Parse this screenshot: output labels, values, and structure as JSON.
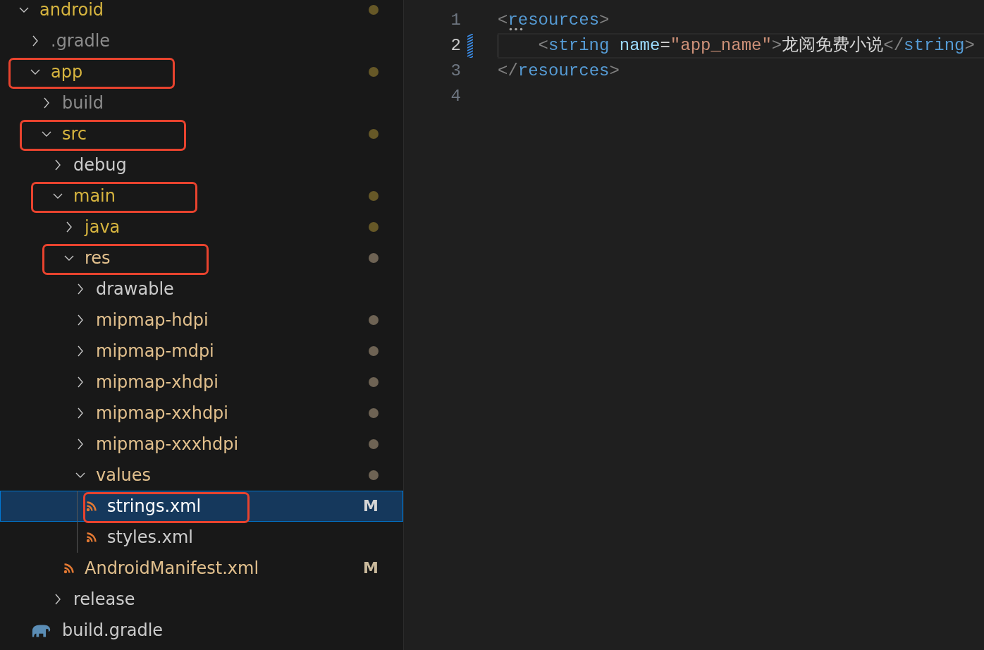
{
  "explorer": {
    "items": [
      {
        "label": "android",
        "kind": "folder",
        "expanded": true,
        "warning": true,
        "modified": false,
        "ignored": false,
        "selected": false,
        "annotated": false,
        "children": [
          {
            "label": ".gradle",
            "kind": "folder",
            "expanded": false,
            "warning": false,
            "modified": false,
            "ignored": true,
            "selected": false,
            "annotated": false
          },
          {
            "label": "app",
            "kind": "folder",
            "expanded": true,
            "warning": true,
            "modified": false,
            "ignored": false,
            "selected": false,
            "annotated": true,
            "children": [
              {
                "label": "build",
                "kind": "folder",
                "expanded": false,
                "warning": false,
                "modified": false,
                "ignored": true,
                "selected": false,
                "annotated": false
              },
              {
                "label": "src",
                "kind": "folder",
                "expanded": true,
                "warning": true,
                "modified": false,
                "ignored": false,
                "selected": false,
                "annotated": true,
                "children": [
                  {
                    "label": "debug",
                    "kind": "folder",
                    "expanded": false,
                    "warning": false,
                    "modified": false,
                    "ignored": false,
                    "selected": false,
                    "annotated": false
                  },
                  {
                    "label": "main",
                    "kind": "folder",
                    "expanded": true,
                    "warning": true,
                    "modified": false,
                    "ignored": false,
                    "selected": false,
                    "annotated": true,
                    "children": [
                      {
                        "label": "java",
                        "kind": "folder",
                        "expanded": false,
                        "warning": true,
                        "modified": false,
                        "ignored": false,
                        "selected": false,
                        "annotated": false
                      },
                      {
                        "label": "res",
                        "kind": "folder",
                        "expanded": true,
                        "warning": false,
                        "modified": true,
                        "ignored": false,
                        "selected": false,
                        "annotated": true,
                        "children": [
                          {
                            "label": "drawable",
                            "kind": "folder",
                            "expanded": false,
                            "warning": false,
                            "modified": false,
                            "ignored": false,
                            "selected": false,
                            "annotated": false
                          },
                          {
                            "label": "mipmap-hdpi",
                            "kind": "folder",
                            "expanded": false,
                            "warning": false,
                            "modified": true,
                            "ignored": false,
                            "selected": false,
                            "annotated": false
                          },
                          {
                            "label": "mipmap-mdpi",
                            "kind": "folder",
                            "expanded": false,
                            "warning": false,
                            "modified": true,
                            "ignored": false,
                            "selected": false,
                            "annotated": false
                          },
                          {
                            "label": "mipmap-xhdpi",
                            "kind": "folder",
                            "expanded": false,
                            "warning": false,
                            "modified": true,
                            "ignored": false,
                            "selected": false,
                            "annotated": false
                          },
                          {
                            "label": "mipmap-xxhdpi",
                            "kind": "folder",
                            "expanded": false,
                            "warning": false,
                            "modified": true,
                            "ignored": false,
                            "selected": false,
                            "annotated": false
                          },
                          {
                            "label": "mipmap-xxxhdpi",
                            "kind": "folder",
                            "expanded": false,
                            "warning": false,
                            "modified": true,
                            "ignored": false,
                            "selected": false,
                            "annotated": false
                          },
                          {
                            "label": "values",
                            "kind": "folder",
                            "expanded": true,
                            "warning": false,
                            "modified": true,
                            "ignored": false,
                            "selected": false,
                            "annotated": false,
                            "children": [
                              {
                                "label": "strings.xml",
                                "kind": "xml",
                                "warning": false,
                                "modified": true,
                                "ignored": false,
                                "badge": "M",
                                "selected": true,
                                "annotated": true
                              },
                              {
                                "label": "styles.xml",
                                "kind": "xml",
                                "warning": false,
                                "modified": false,
                                "ignored": false,
                                "selected": false,
                                "annotated": false
                              }
                            ]
                          }
                        ]
                      },
                      {
                        "label": "AndroidManifest.xml",
                        "kind": "xml",
                        "warning": false,
                        "modified": true,
                        "ignored": false,
                        "badge": "M",
                        "selected": false,
                        "annotated": false
                      }
                    ]
                  },
                  {
                    "label": "release",
                    "kind": "folder",
                    "expanded": false,
                    "warning": false,
                    "modified": false,
                    "ignored": false,
                    "selected": false,
                    "annotated": false
                  }
                ]
              },
              {
                "label": "build.gradle",
                "kind": "gradle",
                "warning": false,
                "modified": false,
                "ignored": false,
                "selected": false,
                "annotated": false
              }
            ]
          }
        ]
      }
    ]
  },
  "editor": {
    "lines": [
      {
        "number": "1",
        "active": false,
        "changed": false,
        "hint": true,
        "indented": false,
        "tokens": [
          {
            "kind": "punct",
            "text": "<"
          },
          {
            "kind": "tag",
            "text": "resources"
          },
          {
            "kind": "punct",
            "text": ">"
          }
        ]
      },
      {
        "number": "2",
        "active": true,
        "changed": true,
        "hint": false,
        "indented": true,
        "tokens": [
          {
            "kind": "punct",
            "text": "<"
          },
          {
            "kind": "tag",
            "text": "string"
          },
          {
            "kind": "attr",
            "text": "name"
          },
          {
            "kind": "text",
            "text": "="
          },
          {
            "kind": "string",
            "text": "\"app_name\""
          },
          {
            "kind": "punct",
            "text": ">"
          },
          {
            "kind": "text",
            "text": "龙阅免费小说"
          },
          {
            "kind": "punct",
            "text": "</"
          },
          {
            "kind": "tag",
            "text": "string"
          },
          {
            "kind": "punct",
            "text": ">"
          }
        ]
      },
      {
        "number": "3",
        "active": false,
        "changed": false,
        "hint": false,
        "indented": false,
        "tokens": [
          {
            "kind": "punct",
            "text": "</"
          },
          {
            "kind": "tag",
            "text": "resources"
          },
          {
            "kind": "punct",
            "text": ">"
          }
        ]
      },
      {
        "number": "4",
        "active": false,
        "changed": false,
        "hint": false,
        "indented": false
      }
    ]
  }
}
